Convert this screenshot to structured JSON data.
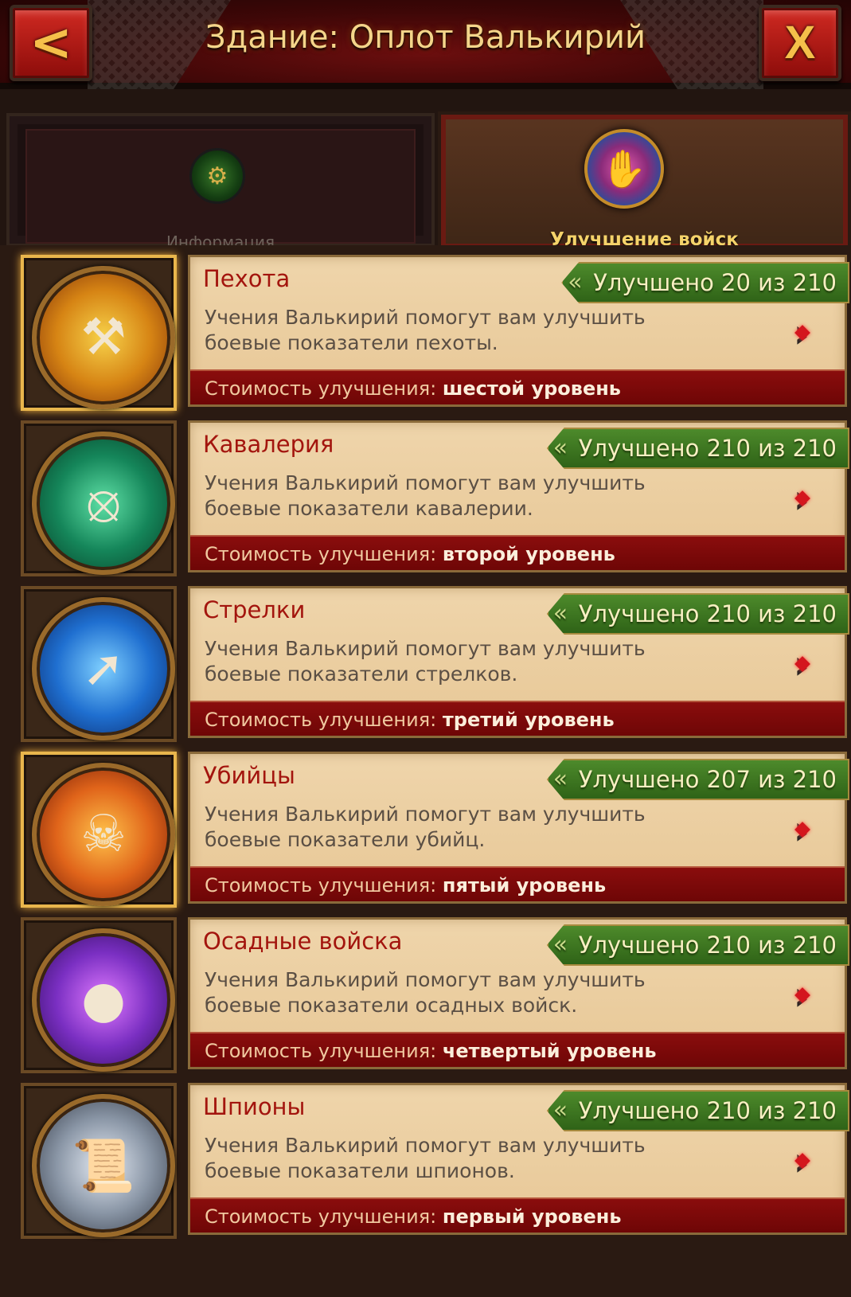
{
  "header": {
    "title": "Здание: Оплот Валькирий",
    "back_glyph": "<",
    "close_glyph": "X"
  },
  "tabs": [
    {
      "label": "Информация",
      "icon": "torch-icon",
      "active": false
    },
    {
      "label": "Улучшение войск",
      "icon": "gauntlet-icon",
      "active": true
    }
  ],
  "units": [
    {
      "name": "Пехота",
      "progress": "Улучшено 20 из 210",
      "upgraded": 20,
      "total": 210,
      "desc1": "Учения Валькирий помогут вам улучшить",
      "desc2": "боевые показатели пехоты.",
      "cost_label": "Стоимость улучшения:",
      "cost_level": "шестой уровень",
      "icon": "hammer-shield-icon",
      "medal_color": "#e2a21a",
      "selected": true
    },
    {
      "name": "Кавалерия",
      "progress": "Улучшено 210 из 210",
      "upgraded": 210,
      "total": 210,
      "desc1": "Учения Валькирий помогут вам улучшить",
      "desc2": "боевые показатели кавалерии.",
      "cost_label": "Стоимость улучшения:",
      "cost_level": "второй уровень",
      "icon": "horseshoe-icon",
      "medal_color": "#1aa36b",
      "selected": false
    },
    {
      "name": "Стрелки",
      "progress": "Улучшено 210 из 210",
      "upgraded": 210,
      "total": 210,
      "desc1": "Учения Валькирий помогут вам улучшить",
      "desc2": "боевые показатели стрелков.",
      "cost_label": "Стоимость улучшения:",
      "cost_level": "третий уровень",
      "icon": "bow-icon",
      "medal_color": "#1f6fd0",
      "selected": false
    },
    {
      "name": "Убийцы",
      "progress": "Улучшено 207 из 210",
      "upgraded": 207,
      "total": 210,
      "desc1": "Учения Валькирий помогут вам улучшить",
      "desc2": "боевые показатели убийц.",
      "cost_label": "Стоимость улучшения:",
      "cost_level": "пятый уровень",
      "icon": "axe-skull-icon",
      "medal_color": "#e0641a",
      "selected": true
    },
    {
      "name": "Осадные войска",
      "progress": "Улучшено 210 из 210",
      "upgraded": 210,
      "total": 210,
      "desc1": "Учения Валькирий помогут вам улучшить",
      "desc2": "боевые показатели осадных войск.",
      "cost_label": "Стоимость улучшения:",
      "cost_level": "четвертый уровень",
      "icon": "catapult-stone-icon",
      "medal_color": "#7a2fc2",
      "selected": false
    },
    {
      "name": "Шпионы",
      "progress": "Улучшено 210 из 210",
      "upgraded": 210,
      "total": 210,
      "desc1": "Учения Валькирий помогут вам улучшить",
      "desc2": "боевые показатели шпионов.",
      "cost_label": "Стоимость улучшения:",
      "cost_level": "первый уровень",
      "icon": "scroll-dagger-icon",
      "medal_color": "#8a96a6",
      "selected": false
    }
  ]
}
